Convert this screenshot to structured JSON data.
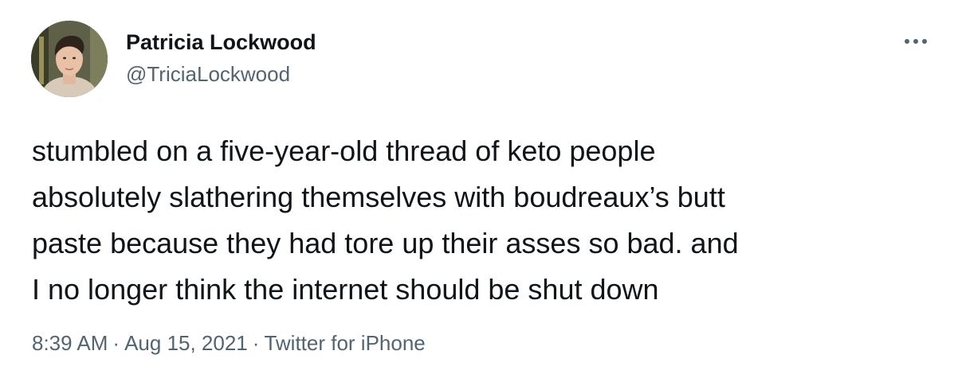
{
  "author": {
    "display_name": "Patricia Lockwood",
    "handle": "@TriciaLockwood"
  },
  "tweet": {
    "lines": [
      "stumbled on a five-year-old thread of keto people",
      "absolutely slathering themselves with boudreaux’s butt",
      "paste because they had tore up their asses so bad. and",
      "I no longer think the internet should be shut down"
    ]
  },
  "meta": {
    "time": "8:39 AM",
    "separator": "·",
    "date": "Aug 15, 2021",
    "source": "Twitter for iPhone"
  },
  "icons": {
    "more": "more-horizontal-icon"
  },
  "colors": {
    "text_primary": "#0f1419",
    "text_secondary": "#536471",
    "background": "#ffffff"
  }
}
